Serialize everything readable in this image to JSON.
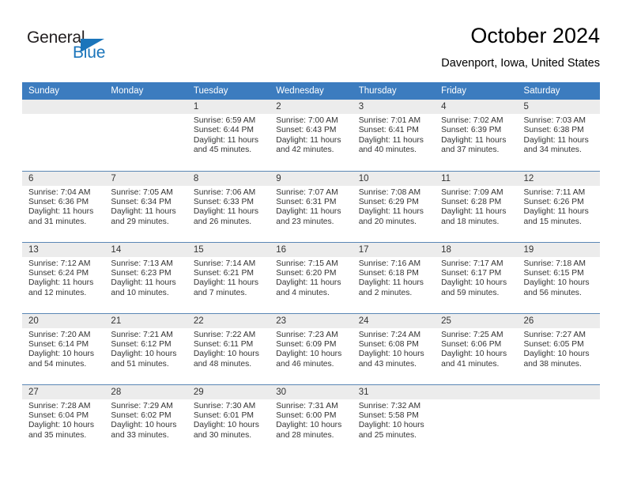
{
  "logo": {
    "primary_text": "General",
    "secondary_text": "Blue",
    "primary_color": "#231f20",
    "secondary_color": "#1b75bb",
    "mark": "triangle-icon"
  },
  "header": {
    "title": "October 2024",
    "subtitle": "Davenport, Iowa, United States"
  },
  "colors": {
    "header_row_bg": "#3c7cbf",
    "header_row_text": "#ffffff",
    "daynum_bg": "#ececec",
    "row_divider": "#5b87b5",
    "body_text": "#333333"
  },
  "weekdays": [
    "Sunday",
    "Monday",
    "Tuesday",
    "Wednesday",
    "Thursday",
    "Friday",
    "Saturday"
  ],
  "weeks": [
    [
      {
        "empty": true
      },
      {
        "empty": true
      },
      {
        "day": "1",
        "sunrise": "Sunrise: 6:59 AM",
        "sunset": "Sunset: 6:44 PM",
        "daylight1": "Daylight: 11 hours",
        "daylight2": "and 45 minutes."
      },
      {
        "day": "2",
        "sunrise": "Sunrise: 7:00 AM",
        "sunset": "Sunset: 6:43 PM",
        "daylight1": "Daylight: 11 hours",
        "daylight2": "and 42 minutes."
      },
      {
        "day": "3",
        "sunrise": "Sunrise: 7:01 AM",
        "sunset": "Sunset: 6:41 PM",
        "daylight1": "Daylight: 11 hours",
        "daylight2": "and 40 minutes."
      },
      {
        "day": "4",
        "sunrise": "Sunrise: 7:02 AM",
        "sunset": "Sunset: 6:39 PM",
        "daylight1": "Daylight: 11 hours",
        "daylight2": "and 37 minutes."
      },
      {
        "day": "5",
        "sunrise": "Sunrise: 7:03 AM",
        "sunset": "Sunset: 6:38 PM",
        "daylight1": "Daylight: 11 hours",
        "daylight2": "and 34 minutes."
      }
    ],
    [
      {
        "day": "6",
        "sunrise": "Sunrise: 7:04 AM",
        "sunset": "Sunset: 6:36 PM",
        "daylight1": "Daylight: 11 hours",
        "daylight2": "and 31 minutes."
      },
      {
        "day": "7",
        "sunrise": "Sunrise: 7:05 AM",
        "sunset": "Sunset: 6:34 PM",
        "daylight1": "Daylight: 11 hours",
        "daylight2": "and 29 minutes."
      },
      {
        "day": "8",
        "sunrise": "Sunrise: 7:06 AM",
        "sunset": "Sunset: 6:33 PM",
        "daylight1": "Daylight: 11 hours",
        "daylight2": "and 26 minutes."
      },
      {
        "day": "9",
        "sunrise": "Sunrise: 7:07 AM",
        "sunset": "Sunset: 6:31 PM",
        "daylight1": "Daylight: 11 hours",
        "daylight2": "and 23 minutes."
      },
      {
        "day": "10",
        "sunrise": "Sunrise: 7:08 AM",
        "sunset": "Sunset: 6:29 PM",
        "daylight1": "Daylight: 11 hours",
        "daylight2": "and 20 minutes."
      },
      {
        "day": "11",
        "sunrise": "Sunrise: 7:09 AM",
        "sunset": "Sunset: 6:28 PM",
        "daylight1": "Daylight: 11 hours",
        "daylight2": "and 18 minutes."
      },
      {
        "day": "12",
        "sunrise": "Sunrise: 7:11 AM",
        "sunset": "Sunset: 6:26 PM",
        "daylight1": "Daylight: 11 hours",
        "daylight2": "and 15 minutes."
      }
    ],
    [
      {
        "day": "13",
        "sunrise": "Sunrise: 7:12 AM",
        "sunset": "Sunset: 6:24 PM",
        "daylight1": "Daylight: 11 hours",
        "daylight2": "and 12 minutes."
      },
      {
        "day": "14",
        "sunrise": "Sunrise: 7:13 AM",
        "sunset": "Sunset: 6:23 PM",
        "daylight1": "Daylight: 11 hours",
        "daylight2": "and 10 minutes."
      },
      {
        "day": "15",
        "sunrise": "Sunrise: 7:14 AM",
        "sunset": "Sunset: 6:21 PM",
        "daylight1": "Daylight: 11 hours",
        "daylight2": "and 7 minutes."
      },
      {
        "day": "16",
        "sunrise": "Sunrise: 7:15 AM",
        "sunset": "Sunset: 6:20 PM",
        "daylight1": "Daylight: 11 hours",
        "daylight2": "and 4 minutes."
      },
      {
        "day": "17",
        "sunrise": "Sunrise: 7:16 AM",
        "sunset": "Sunset: 6:18 PM",
        "daylight1": "Daylight: 11 hours",
        "daylight2": "and 2 minutes."
      },
      {
        "day": "18",
        "sunrise": "Sunrise: 7:17 AM",
        "sunset": "Sunset: 6:17 PM",
        "daylight1": "Daylight: 10 hours",
        "daylight2": "and 59 minutes."
      },
      {
        "day": "19",
        "sunrise": "Sunrise: 7:18 AM",
        "sunset": "Sunset: 6:15 PM",
        "daylight1": "Daylight: 10 hours",
        "daylight2": "and 56 minutes."
      }
    ],
    [
      {
        "day": "20",
        "sunrise": "Sunrise: 7:20 AM",
        "sunset": "Sunset: 6:14 PM",
        "daylight1": "Daylight: 10 hours",
        "daylight2": "and 54 minutes."
      },
      {
        "day": "21",
        "sunrise": "Sunrise: 7:21 AM",
        "sunset": "Sunset: 6:12 PM",
        "daylight1": "Daylight: 10 hours",
        "daylight2": "and 51 minutes."
      },
      {
        "day": "22",
        "sunrise": "Sunrise: 7:22 AM",
        "sunset": "Sunset: 6:11 PM",
        "daylight1": "Daylight: 10 hours",
        "daylight2": "and 48 minutes."
      },
      {
        "day": "23",
        "sunrise": "Sunrise: 7:23 AM",
        "sunset": "Sunset: 6:09 PM",
        "daylight1": "Daylight: 10 hours",
        "daylight2": "and 46 minutes."
      },
      {
        "day": "24",
        "sunrise": "Sunrise: 7:24 AM",
        "sunset": "Sunset: 6:08 PM",
        "daylight1": "Daylight: 10 hours",
        "daylight2": "and 43 minutes."
      },
      {
        "day": "25",
        "sunrise": "Sunrise: 7:25 AM",
        "sunset": "Sunset: 6:06 PM",
        "daylight1": "Daylight: 10 hours",
        "daylight2": "and 41 minutes."
      },
      {
        "day": "26",
        "sunrise": "Sunrise: 7:27 AM",
        "sunset": "Sunset: 6:05 PM",
        "daylight1": "Daylight: 10 hours",
        "daylight2": "and 38 minutes."
      }
    ],
    [
      {
        "day": "27",
        "sunrise": "Sunrise: 7:28 AM",
        "sunset": "Sunset: 6:04 PM",
        "daylight1": "Daylight: 10 hours",
        "daylight2": "and 35 minutes."
      },
      {
        "day": "28",
        "sunrise": "Sunrise: 7:29 AM",
        "sunset": "Sunset: 6:02 PM",
        "daylight1": "Daylight: 10 hours",
        "daylight2": "and 33 minutes."
      },
      {
        "day": "29",
        "sunrise": "Sunrise: 7:30 AM",
        "sunset": "Sunset: 6:01 PM",
        "daylight1": "Daylight: 10 hours",
        "daylight2": "and 30 minutes."
      },
      {
        "day": "30",
        "sunrise": "Sunrise: 7:31 AM",
        "sunset": "Sunset: 6:00 PM",
        "daylight1": "Daylight: 10 hours",
        "daylight2": "and 28 minutes."
      },
      {
        "day": "31",
        "sunrise": "Sunrise: 7:32 AM",
        "sunset": "Sunset: 5:58 PM",
        "daylight1": "Daylight: 10 hours",
        "daylight2": "and 25 minutes."
      },
      {
        "empty": true
      },
      {
        "empty": true
      }
    ]
  ]
}
